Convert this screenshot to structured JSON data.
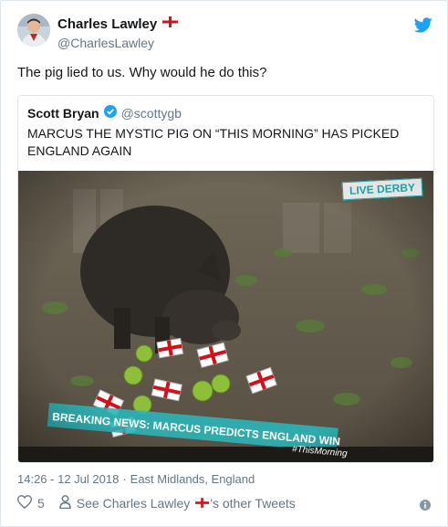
{
  "author": {
    "name": "Charles Lawley",
    "handle": "@CharlesLawley"
  },
  "tweet": {
    "text": "The pig lied to us. Why would he do this?"
  },
  "quoted": {
    "name": "Scott Bryan",
    "handle": "@scottygb",
    "text": "MARCUS THE MYSTIC PIG ON “THIS MORNING” HAS PICKED ENGLAND AGAIN",
    "media": {
      "live_badge": "LIVE DERBY",
      "ticker": "BREAKING NEWS: MARCUS PREDICTS ENGLAND WIN",
      "hashtag": "#ThisMorning"
    }
  },
  "meta": {
    "time": "14:26 - 12 Jul 2018",
    "separator": "·",
    "location": "East Midlands, England"
  },
  "actions": {
    "likes": "5",
    "see_prefix": "See Charles Lawley",
    "see_suffix": "'s other Tweets"
  },
  "colors": {
    "accent": "#1da1f2",
    "secondary_text": "#657786",
    "heart": "#657786"
  }
}
